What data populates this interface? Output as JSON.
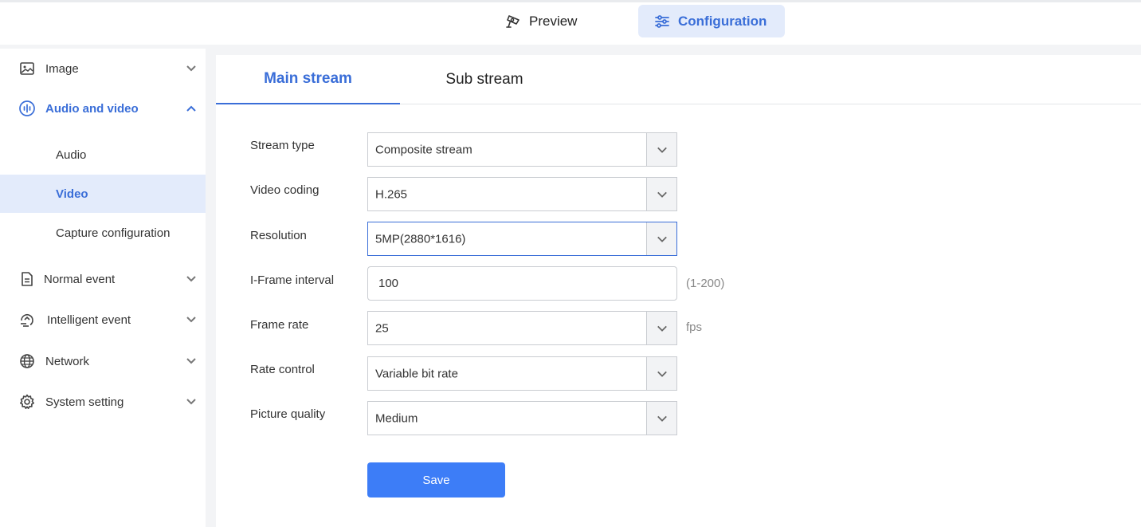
{
  "header": {
    "tabs": [
      {
        "label": "Preview",
        "icon": "camera-icon"
      },
      {
        "label": "Configuration",
        "icon": "sliders-icon"
      }
    ]
  },
  "sidebar": {
    "items": [
      {
        "label": "Image",
        "icon": "image-icon",
        "expanded": false
      },
      {
        "label": "Audio and video",
        "icon": "audio-wave-icon",
        "expanded": true,
        "children": [
          {
            "label": "Audio"
          },
          {
            "label": "Video",
            "selected": true
          },
          {
            "label": "Capture configuration"
          }
        ]
      },
      {
        "label": "Normal event",
        "icon": "document-icon",
        "expanded": false
      },
      {
        "label": "Intelligent event",
        "icon": "intelligent-event-icon",
        "expanded": false
      },
      {
        "label": "Network",
        "icon": "globe-icon",
        "expanded": false
      },
      {
        "label": "System setting",
        "icon": "gear-icon",
        "expanded": false
      }
    ]
  },
  "main": {
    "tabs": [
      {
        "label": "Main stream",
        "active": true
      },
      {
        "label": "Sub stream",
        "active": false
      }
    ],
    "form": {
      "stream_type": {
        "label": "Stream type",
        "value": "Composite stream"
      },
      "video_coding": {
        "label": "Video coding",
        "value": "H.265"
      },
      "resolution": {
        "label": "Resolution",
        "value": "5MP(2880*1616)"
      },
      "iframe_interval": {
        "label": "I-Frame interval",
        "value": "100",
        "hint": "(1-200)"
      },
      "frame_rate": {
        "label": "Frame rate",
        "value": "25",
        "unit": "fps"
      },
      "rate_control": {
        "label": "Rate control",
        "value": "Variable bit rate"
      },
      "picture_quality": {
        "label": "Picture quality",
        "value": "Medium"
      }
    },
    "save_label": "Save"
  },
  "colors": {
    "accent": "#3a6ed8",
    "save_button": "#3d7df7",
    "selected_bg": "#e3ebfb"
  }
}
